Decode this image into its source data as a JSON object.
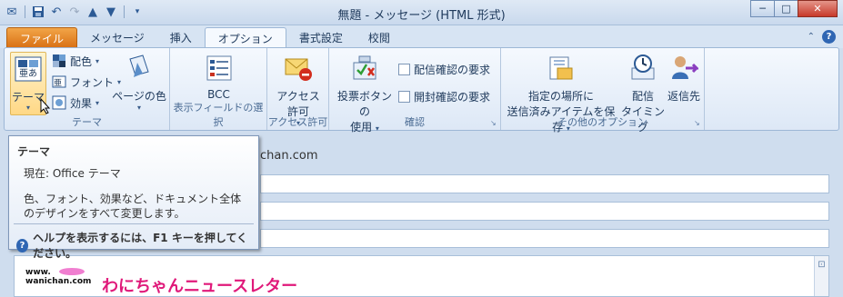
{
  "window": {
    "title": "無題 - メッセージ (HTML 形式)",
    "controls": {
      "minimize": "─",
      "maximize": "□",
      "close": "✕"
    }
  },
  "qat": {
    "icons": [
      "outlook-icon",
      "save-icon",
      "undo-icon",
      "redo-icon",
      "up-arrow-icon",
      "down-arrow-icon",
      "customize-icon"
    ]
  },
  "tabs": [
    {
      "label": "ファイル",
      "kind": "file"
    },
    {
      "label": "メッセージ"
    },
    {
      "label": "挿入"
    },
    {
      "label": "オプション",
      "active": true
    },
    {
      "label": "書式設定"
    },
    {
      "label": "校閲"
    }
  ],
  "ribbon": {
    "theme_group": {
      "label": "テーマ",
      "theme_button": "テーマ",
      "colors": "配色",
      "fonts": "フォント",
      "effects": "効果",
      "page_color": "ページの色"
    },
    "show_fields_group": {
      "label": "表示フィールドの選択",
      "bcc": "BCC"
    },
    "permission_group": {
      "label": "アクセス許可",
      "permission_line1": "アクセス",
      "permission_line2": "許可"
    },
    "tracking_group": {
      "label": "確認",
      "voting_line1": "投票ボタンの",
      "voting_line2": "使用",
      "delivery_receipt": "配信確認の要求",
      "read_receipt": "開封確認の要求"
    },
    "more_options_group": {
      "label": "その他のオプション",
      "save_sent_line1": "指定の場所に",
      "save_sent_line2": "送信済みアイテムを保存",
      "delay_line1": "配信",
      "delay_line2": "タイミング",
      "direct_replies": "返信先"
    }
  },
  "message": {
    "from_text": "chan.com",
    "newsletter_title": "わにちゃんニュースレター",
    "logo_line1": "www.",
    "logo_line2": "wanichan.com"
  },
  "tooltip": {
    "title": "テーマ",
    "current": "現在: Office テーマ",
    "description": "色、フォント、効果など、ドキュメント全体のデザインをすべて変更します。",
    "help": "ヘルプを表示するには、F1 キーを押してください。"
  },
  "colors": {
    "file_tab": "#e07d1f",
    "newsletter": "#e0197a",
    "accent": "#2f66b3"
  }
}
